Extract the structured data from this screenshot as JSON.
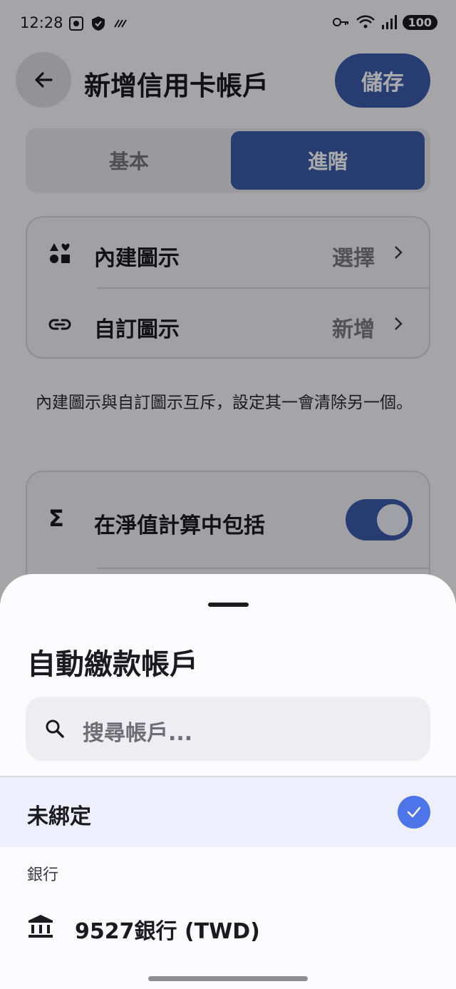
{
  "status_bar": {
    "time": "12:28",
    "battery": "100"
  },
  "header": {
    "title": "新增信用卡帳戶",
    "save_label": "儲存"
  },
  "tabs": [
    {
      "label": "基本"
    },
    {
      "label": "進階"
    }
  ],
  "icon_card": {
    "rows": [
      {
        "label": "內建圖示",
        "value": "選擇",
        "icon": "shapes-icon"
      },
      {
        "label": "自訂圖示",
        "value": "新增",
        "icon": "link-icon"
      }
    ]
  },
  "note": "內建圖示與自訂圖示互斥，設定其一會清除另一個。",
  "net_worth": {
    "label": "在淨值計算中包括",
    "icon": "sigma-icon",
    "enabled": true
  },
  "sheet": {
    "title": "自動繳款帳戶",
    "search_placeholder": "搜尋帳戶...",
    "selected_option": "未綁定",
    "group_label": "銀行",
    "bank_option": "9527銀行 (TWD)"
  },
  "colors": {
    "accent": "#3b5bab",
    "check": "#4d74e8",
    "selected_bg": "#edf0fc"
  }
}
